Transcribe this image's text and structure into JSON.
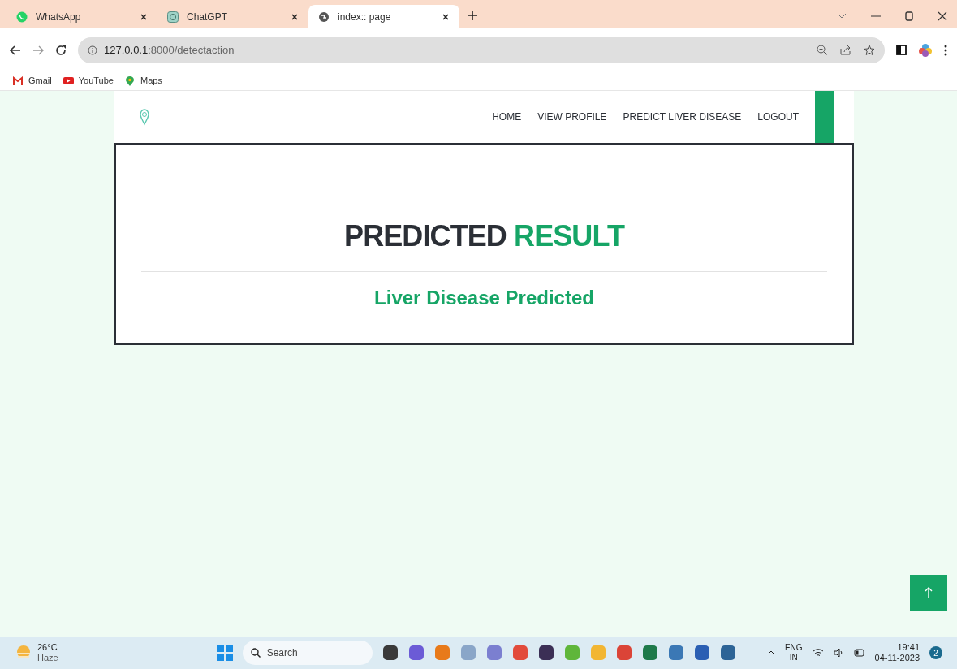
{
  "browser": {
    "tabs": [
      {
        "title": "WhatsApp",
        "kind": "whatsapp",
        "selected": false
      },
      {
        "title": "ChatGPT",
        "kind": "chatgpt",
        "selected": false
      },
      {
        "title": "index:: page",
        "kind": "globe",
        "selected": true
      }
    ],
    "url_host": "127.0.0.1",
    "url_rest": ":8000/detectaction",
    "bookmarks": [
      {
        "label": "Gmail",
        "kind": "gmail"
      },
      {
        "label": "YouTube",
        "kind": "youtube"
      },
      {
        "label": "Maps",
        "kind": "maps"
      }
    ]
  },
  "nav": {
    "items": [
      "HOME",
      "VIEW PROFILE",
      "PREDICT LIVER DISEASE",
      "LOGOUT"
    ]
  },
  "result": {
    "title_dark": "PREDICTED",
    "title_accent": "RESULT",
    "message": "Liver Disease Predicted"
  },
  "taskbar": {
    "temperature": "26°C",
    "weather": "Haze",
    "search_placeholder": "Search",
    "language": "ENG",
    "region": "IN",
    "time": "19:41",
    "date": "04-11-2023",
    "notifications": "2"
  }
}
